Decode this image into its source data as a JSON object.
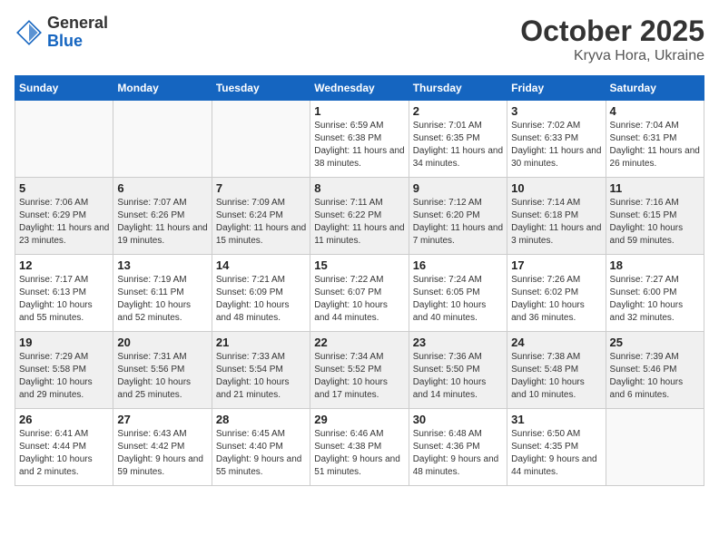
{
  "header": {
    "logo_line1": "General",
    "logo_line2": "Blue",
    "title": "October 2025",
    "subtitle": "Kryva Hora, Ukraine"
  },
  "calendar": {
    "weekdays": [
      "Sunday",
      "Monday",
      "Tuesday",
      "Wednesday",
      "Thursday",
      "Friday",
      "Saturday"
    ],
    "weeks": [
      [
        {
          "day": "",
          "info": ""
        },
        {
          "day": "",
          "info": ""
        },
        {
          "day": "",
          "info": ""
        },
        {
          "day": "1",
          "info": "Sunrise: 6:59 AM\nSunset: 6:38 PM\nDaylight: 11 hours\nand 38 minutes."
        },
        {
          "day": "2",
          "info": "Sunrise: 7:01 AM\nSunset: 6:35 PM\nDaylight: 11 hours\nand 34 minutes."
        },
        {
          "day": "3",
          "info": "Sunrise: 7:02 AM\nSunset: 6:33 PM\nDaylight: 11 hours\nand 30 minutes."
        },
        {
          "day": "4",
          "info": "Sunrise: 7:04 AM\nSunset: 6:31 PM\nDaylight: 11 hours\nand 26 minutes."
        }
      ],
      [
        {
          "day": "5",
          "info": "Sunrise: 7:06 AM\nSunset: 6:29 PM\nDaylight: 11 hours\nand 23 minutes."
        },
        {
          "day": "6",
          "info": "Sunrise: 7:07 AM\nSunset: 6:26 PM\nDaylight: 11 hours\nand 19 minutes."
        },
        {
          "day": "7",
          "info": "Sunrise: 7:09 AM\nSunset: 6:24 PM\nDaylight: 11 hours\nand 15 minutes."
        },
        {
          "day": "8",
          "info": "Sunrise: 7:11 AM\nSunset: 6:22 PM\nDaylight: 11 hours\nand 11 minutes."
        },
        {
          "day": "9",
          "info": "Sunrise: 7:12 AM\nSunset: 6:20 PM\nDaylight: 11 hours\nand 7 minutes."
        },
        {
          "day": "10",
          "info": "Sunrise: 7:14 AM\nSunset: 6:18 PM\nDaylight: 11 hours\nand 3 minutes."
        },
        {
          "day": "11",
          "info": "Sunrise: 7:16 AM\nSunset: 6:15 PM\nDaylight: 10 hours\nand 59 minutes."
        }
      ],
      [
        {
          "day": "12",
          "info": "Sunrise: 7:17 AM\nSunset: 6:13 PM\nDaylight: 10 hours\nand 55 minutes."
        },
        {
          "day": "13",
          "info": "Sunrise: 7:19 AM\nSunset: 6:11 PM\nDaylight: 10 hours\nand 52 minutes."
        },
        {
          "day": "14",
          "info": "Sunrise: 7:21 AM\nSunset: 6:09 PM\nDaylight: 10 hours\nand 48 minutes."
        },
        {
          "day": "15",
          "info": "Sunrise: 7:22 AM\nSunset: 6:07 PM\nDaylight: 10 hours\nand 44 minutes."
        },
        {
          "day": "16",
          "info": "Sunrise: 7:24 AM\nSunset: 6:05 PM\nDaylight: 10 hours\nand 40 minutes."
        },
        {
          "day": "17",
          "info": "Sunrise: 7:26 AM\nSunset: 6:02 PM\nDaylight: 10 hours\nand 36 minutes."
        },
        {
          "day": "18",
          "info": "Sunrise: 7:27 AM\nSunset: 6:00 PM\nDaylight: 10 hours\nand 32 minutes."
        }
      ],
      [
        {
          "day": "19",
          "info": "Sunrise: 7:29 AM\nSunset: 5:58 PM\nDaylight: 10 hours\nand 29 minutes."
        },
        {
          "day": "20",
          "info": "Sunrise: 7:31 AM\nSunset: 5:56 PM\nDaylight: 10 hours\nand 25 minutes."
        },
        {
          "day": "21",
          "info": "Sunrise: 7:33 AM\nSunset: 5:54 PM\nDaylight: 10 hours\nand 21 minutes."
        },
        {
          "day": "22",
          "info": "Sunrise: 7:34 AM\nSunset: 5:52 PM\nDaylight: 10 hours\nand 17 minutes."
        },
        {
          "day": "23",
          "info": "Sunrise: 7:36 AM\nSunset: 5:50 PM\nDaylight: 10 hours\nand 14 minutes."
        },
        {
          "day": "24",
          "info": "Sunrise: 7:38 AM\nSunset: 5:48 PM\nDaylight: 10 hours\nand 10 minutes."
        },
        {
          "day": "25",
          "info": "Sunrise: 7:39 AM\nSunset: 5:46 PM\nDaylight: 10 hours\nand 6 minutes."
        }
      ],
      [
        {
          "day": "26",
          "info": "Sunrise: 6:41 AM\nSunset: 4:44 PM\nDaylight: 10 hours\nand 2 minutes."
        },
        {
          "day": "27",
          "info": "Sunrise: 6:43 AM\nSunset: 4:42 PM\nDaylight: 9 hours\nand 59 minutes."
        },
        {
          "day": "28",
          "info": "Sunrise: 6:45 AM\nSunset: 4:40 PM\nDaylight: 9 hours\nand 55 minutes."
        },
        {
          "day": "29",
          "info": "Sunrise: 6:46 AM\nSunset: 4:38 PM\nDaylight: 9 hours\nand 51 minutes."
        },
        {
          "day": "30",
          "info": "Sunrise: 6:48 AM\nSunset: 4:36 PM\nDaylight: 9 hours\nand 48 minutes."
        },
        {
          "day": "31",
          "info": "Sunrise: 6:50 AM\nSunset: 4:35 PM\nDaylight: 9 hours\nand 44 minutes."
        },
        {
          "day": "",
          "info": ""
        }
      ]
    ]
  }
}
